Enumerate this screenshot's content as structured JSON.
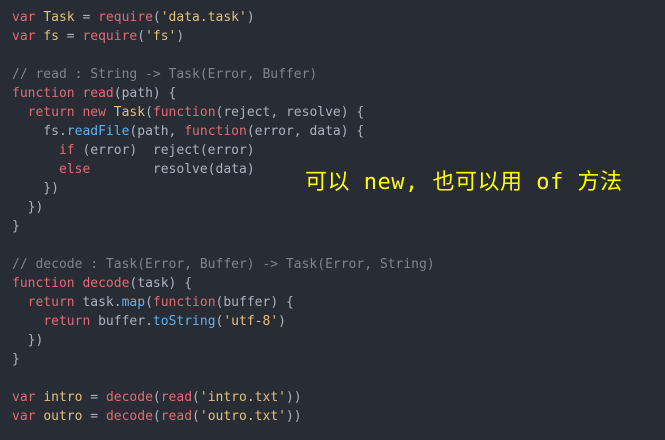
{
  "editor": {
    "lines": [
      [
        {
          "t": "var",
          "c": "k"
        },
        {
          "t": " "
        },
        {
          "t": "Task",
          "c": "v"
        },
        {
          "t": " = "
        },
        {
          "t": "require",
          "c": "fn"
        },
        {
          "t": "("
        },
        {
          "t": "'data.task'",
          "c": "s"
        },
        {
          "t": ")"
        }
      ],
      [
        {
          "t": "var",
          "c": "k"
        },
        {
          "t": " "
        },
        {
          "t": "fs",
          "c": "v"
        },
        {
          "t": " = "
        },
        {
          "t": "require",
          "c": "fn"
        },
        {
          "t": "("
        },
        {
          "t": "'fs'",
          "c": "s"
        },
        {
          "t": ")"
        }
      ],
      [],
      [
        {
          "t": "// read : String -> Task(Error, Buffer)",
          "c": "c"
        }
      ],
      [
        {
          "t": "function",
          "c": "k"
        },
        {
          "t": " "
        },
        {
          "t": "read",
          "c": "fn"
        },
        {
          "t": "(path) {"
        }
      ],
      [
        {
          "t": "  "
        },
        {
          "t": "return",
          "c": "k"
        },
        {
          "t": " "
        },
        {
          "t": "new",
          "c": "k"
        },
        {
          "t": " "
        },
        {
          "t": "Task",
          "c": "v"
        },
        {
          "t": "("
        },
        {
          "t": "function",
          "c": "k"
        },
        {
          "t": "(reject, resolve) {"
        }
      ],
      [
        {
          "t": "    fs."
        },
        {
          "t": "readFile",
          "c": "m"
        },
        {
          "t": "(path, "
        },
        {
          "t": "function",
          "c": "k"
        },
        {
          "t": "(error, data) {"
        }
      ],
      [
        {
          "t": "      "
        },
        {
          "t": "if",
          "c": "k"
        },
        {
          "t": " (error)  reject(error)"
        }
      ],
      [
        {
          "t": "      "
        },
        {
          "t": "else",
          "c": "k"
        },
        {
          "t": "        resolve(data)"
        }
      ],
      [
        {
          "t": "    })"
        }
      ],
      [
        {
          "t": "  })"
        }
      ],
      [
        {
          "t": "}"
        }
      ],
      [],
      [
        {
          "t": "// decode : Task(Error, Buffer) -> Task(Error, String)",
          "c": "c"
        }
      ],
      [
        {
          "t": "function",
          "c": "k"
        },
        {
          "t": " "
        },
        {
          "t": "decode",
          "c": "fn"
        },
        {
          "t": "(task) {"
        }
      ],
      [
        {
          "t": "  "
        },
        {
          "t": "return",
          "c": "k"
        },
        {
          "t": " task."
        },
        {
          "t": "map",
          "c": "m"
        },
        {
          "t": "("
        },
        {
          "t": "function",
          "c": "k"
        },
        {
          "t": "(buffer) {"
        }
      ],
      [
        {
          "t": "    "
        },
        {
          "t": "return",
          "c": "k"
        },
        {
          "t": " buffer."
        },
        {
          "t": "toString",
          "c": "m"
        },
        {
          "t": "("
        },
        {
          "t": "'utf-8'",
          "c": "s"
        },
        {
          "t": ")"
        }
      ],
      [
        {
          "t": "  })"
        }
      ],
      [
        {
          "t": "}"
        }
      ],
      [],
      [
        {
          "t": "var",
          "c": "k"
        },
        {
          "t": " "
        },
        {
          "t": "intro",
          "c": "v"
        },
        {
          "t": " = "
        },
        {
          "t": "decode",
          "c": "fn"
        },
        {
          "t": "("
        },
        {
          "t": "read",
          "c": "fn"
        },
        {
          "t": "("
        },
        {
          "t": "'intro.txt'",
          "c": "s"
        },
        {
          "t": "))"
        }
      ],
      [
        {
          "t": "var",
          "c": "k"
        },
        {
          "t": " "
        },
        {
          "t": "outro",
          "c": "v"
        },
        {
          "t": " = "
        },
        {
          "t": "decode",
          "c": "fn"
        },
        {
          "t": "("
        },
        {
          "t": "read",
          "c": "fn"
        },
        {
          "t": "("
        },
        {
          "t": "'outro.txt'",
          "c": "s"
        },
        {
          "t": "))"
        }
      ]
    ]
  },
  "annotation": {
    "text": "可以 new, 也可以用 of 方法",
    "color": "#ffff00"
  },
  "colors": {
    "background": "#282c34"
  }
}
